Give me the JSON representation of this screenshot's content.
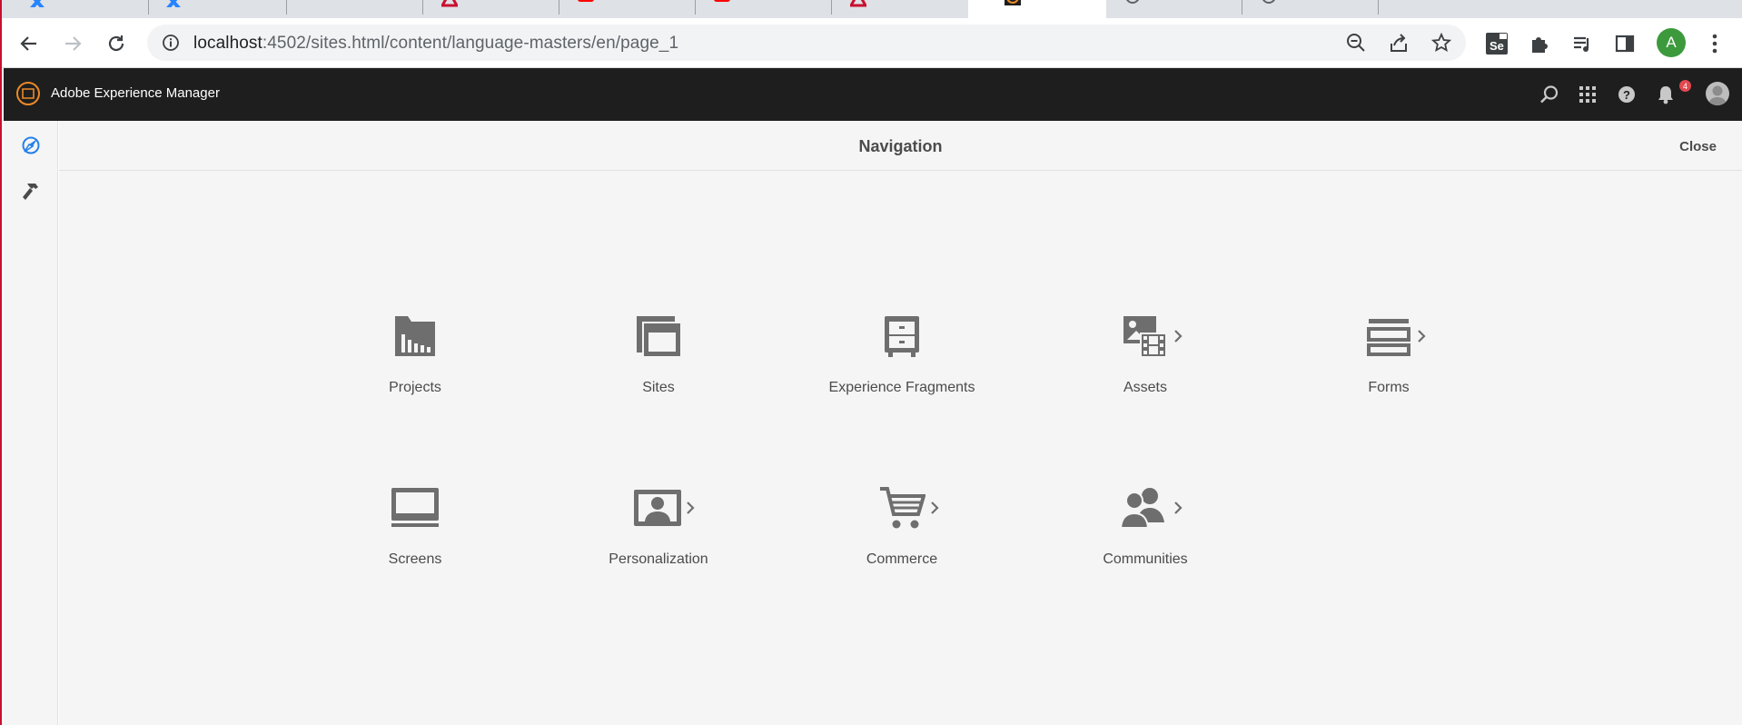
{
  "browser": {
    "url_host": "localhost",
    "url_path": ":4502/sites.html/content/language-masters/en/page_1",
    "profile_initial": "A"
  },
  "aem": {
    "title": "Adobe Experience Manager",
    "notification_count": "4"
  },
  "panel": {
    "title": "Navigation",
    "close_label": "Close"
  },
  "nav_items": [
    {
      "label": "Projects",
      "icon": "projects-icon",
      "has_children": false
    },
    {
      "label": "Sites",
      "icon": "sites-icon",
      "has_children": false
    },
    {
      "label": "Experience Fragments",
      "icon": "experience-fragments-icon",
      "has_children": false
    },
    {
      "label": "Assets",
      "icon": "assets-icon",
      "has_children": true
    },
    {
      "label": "Forms",
      "icon": "forms-icon",
      "has_children": true
    },
    {
      "label": "Screens",
      "icon": "screens-icon",
      "has_children": false
    },
    {
      "label": "Personalization",
      "icon": "personalization-icon",
      "has_children": true
    },
    {
      "label": "Commerce",
      "icon": "commerce-icon",
      "has_children": true
    },
    {
      "label": "Communities",
      "icon": "communities-icon",
      "has_children": true
    }
  ],
  "colors": {
    "header_bg": "#1e1e1e",
    "panel_bg": "#f5f5f5",
    "icon_gray": "#6e6e6e",
    "text_gray": "#4b4b4b",
    "accent_blue": "#2680eb"
  }
}
